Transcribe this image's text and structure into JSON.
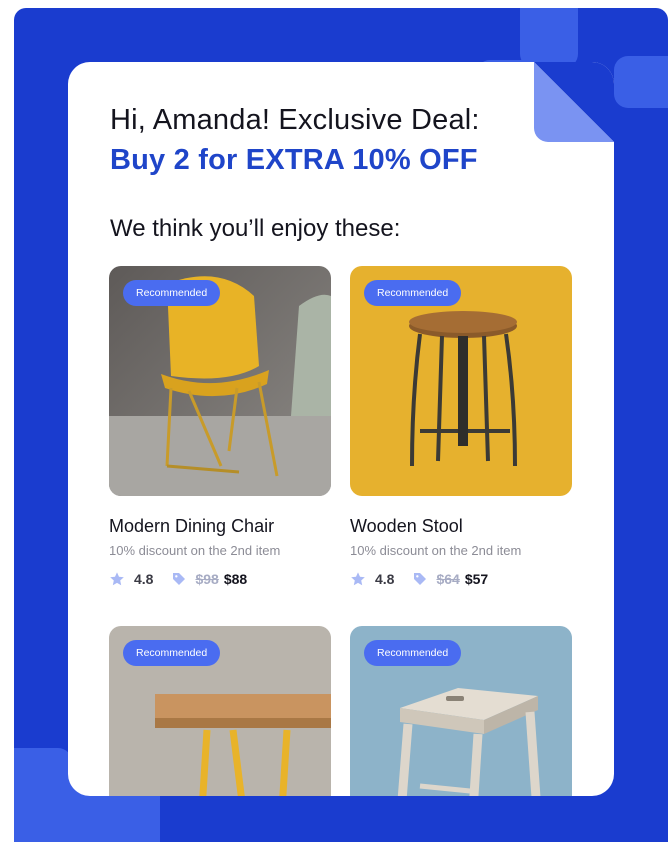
{
  "header": {
    "greeting": "Hi, Amanda! Exclusive Deal:",
    "deal": "Buy 2 for EXTRA 10% OFF",
    "subtitle": "We think you’ll enjoy these:"
  },
  "colors": {
    "frame": "#1a3ccf",
    "accent": "#1f45c9",
    "badge": "#4a6cf0",
    "icon": "#a9b9f5"
  },
  "products": [
    {
      "badge": "Recommended",
      "name": "Modern Dining Chair",
      "promo": "10% discount on the 2nd item",
      "rating": "4.8",
      "old_price": "$98",
      "price": "$88",
      "image": "yellow-chair-photo"
    },
    {
      "badge": "Recommended",
      "name": "Wooden Stool",
      "promo": "10% discount on the 2nd item",
      "rating": "4.8",
      "old_price": "$64",
      "price": "$57",
      "image": "wooden-stool-photo"
    },
    {
      "badge": "Recommended",
      "image": "wooden-table-photo"
    },
    {
      "badge": "Recommended",
      "image": "white-stool-photo"
    }
  ],
  "icons": {
    "rating": "star-icon",
    "price": "tag-icon"
  }
}
